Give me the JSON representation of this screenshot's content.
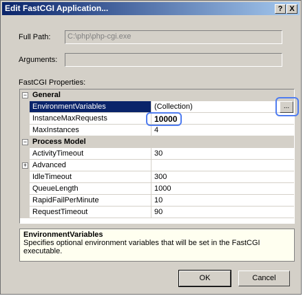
{
  "window": {
    "title": "Edit FastCGI Application...",
    "help_label": "?",
    "close_label": "X"
  },
  "fields": {
    "full_path_label": "Full Path:",
    "full_path_value": "C:\\php\\php-cgi.exe",
    "arguments_label": "Arguments:",
    "arguments_value": ""
  },
  "grid": {
    "section_label": "FastCGI Properties:",
    "categories": {
      "general": "General",
      "process_model": "Process Model"
    },
    "rows": {
      "environment_variables": {
        "name": "EnvironmentVariables",
        "value": "(Collection)"
      },
      "instance_max_requests": {
        "name": "InstanceMaxRequests",
        "value": "10000"
      },
      "max_instances": {
        "name": "MaxInstances",
        "value": "4"
      },
      "activity_timeout": {
        "name": "ActivityTimeout",
        "value": "30"
      },
      "advanced": {
        "name": "Advanced",
        "value": ""
      },
      "idle_timeout": {
        "name": "IdleTimeout",
        "value": "300"
      },
      "queue_length": {
        "name": "QueueLength",
        "value": "1000"
      },
      "rapid_fail_per_minute": {
        "name": "RapidFailPerMinute",
        "value": "10"
      },
      "request_timeout": {
        "name": "RequestTimeout",
        "value": "90"
      }
    },
    "ellipsis_label": "...",
    "expanded_glyph": "−",
    "collapsed_glyph": "+"
  },
  "description": {
    "title": "EnvironmentVariables",
    "text": "Specifies optional environment variables that will be set in the FastCGI executable."
  },
  "buttons": {
    "ok": "OK",
    "cancel": "Cancel"
  },
  "colors": {
    "selection": "#0a246a",
    "highlight": "#4f7cf0",
    "titlebar": "#0a246a"
  }
}
